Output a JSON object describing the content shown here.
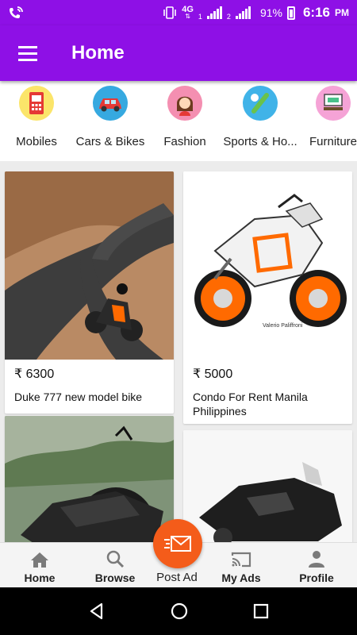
{
  "status": {
    "battery": "91%",
    "time": "6:16",
    "ampm": "PM",
    "network": "4G",
    "sim1": "1",
    "sim2": "2"
  },
  "appbar": {
    "title": "Home"
  },
  "categories": [
    {
      "label": "Mobiles",
      "color": "#fbe56a"
    },
    {
      "label": "Cars & Bikes",
      "color": "#36a9e0"
    },
    {
      "label": "Fashion",
      "color": "#f48fb1"
    },
    {
      "label": "Sports & Ho...",
      "color": "#40b3e8"
    },
    {
      "label": "Furniture",
      "color": "#f5a3d6"
    }
  ],
  "listings": [
    {
      "price": "₹ 6300",
      "title": "Duke 777 new model bike"
    },
    {
      "price": "₹ 5000",
      "title": "Condo For Rent Manila Philippines"
    },
    {
      "price": "",
      "title": ""
    },
    {
      "price": "",
      "title": ""
    }
  ],
  "bottom_nav": {
    "home": "Home",
    "browse": "Browse",
    "post_ad": "Post Ad",
    "my_ads": "My Ads",
    "profile": "Profile"
  },
  "colors": {
    "primary": "#8e10e6",
    "accent": "#f45c1a"
  }
}
